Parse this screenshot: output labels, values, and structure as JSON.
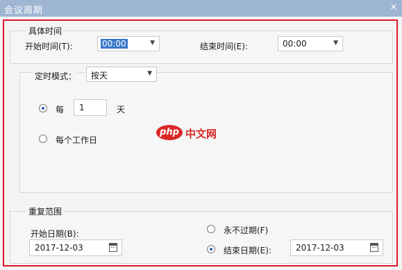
{
  "window": {
    "title": "会议周期",
    "close_label": "×"
  },
  "specific_time": {
    "group_title": "具体时间",
    "start_label": "开始时间(T):",
    "start_value": "00:00",
    "end_label": "结束时间(E):",
    "end_value": "00:00"
  },
  "schedule": {
    "mode_label": "定时模式：",
    "mode_value": "按天",
    "every_label": "每",
    "every_value": "1",
    "unit_label": "天",
    "weekday_label": "每个工作日",
    "selected": "every"
  },
  "watermark": {
    "logo": "php",
    "text": "中文网"
  },
  "repeat": {
    "group_title": "重复范围",
    "start_date_label": "开始日期(B):",
    "start_date_value": "2017-12-03",
    "never_label": "永不过期(F)",
    "end_date_label": "结束日期(E):",
    "end_date_value": "2017-12-03",
    "selected": "end_date"
  },
  "colors": {
    "highlight_frame": "#e0182b",
    "selection": "#3a78c9",
    "titlebar": "#9fb6d3"
  }
}
